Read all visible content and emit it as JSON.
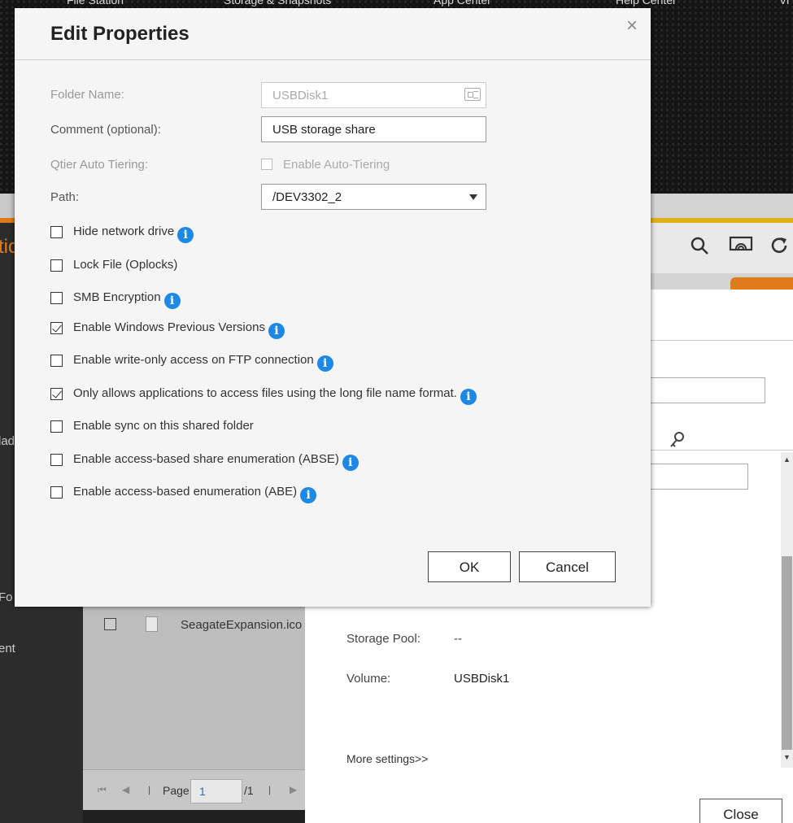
{
  "background": {
    "topnav": [
      "File Station",
      "Storage & Snapshots",
      "App Center",
      "Help Center",
      "Vi"
    ],
    "left_fragments": [
      "tic",
      "lad",
      "Fo",
      "ent"
    ],
    "file_list": {
      "rows": [
        {
          "name": "SeagateExpansion.ico"
        }
      ]
    },
    "pager": {
      "page_label": "Page",
      "page_value": "1",
      "page_total": "/1"
    },
    "details": {
      "storage_pool_label": "Storage Pool:",
      "storage_pool_value": "--",
      "volume_label": "Volume:",
      "volume_value": "USBDisk1",
      "more_settings": "More settings>>",
      "close_label": "Close"
    }
  },
  "modal": {
    "title": "Edit Properties",
    "close_glyph": "×",
    "folder_name": {
      "label": "Folder Name:",
      "value": "USBDisk1"
    },
    "comment": {
      "label": "Comment (optional):",
      "value": "USB storage share"
    },
    "qtier": {
      "label": "Qtier Auto Tiering:",
      "checkbox_label": "Enable Auto-Tiering"
    },
    "path": {
      "label": "Path:",
      "value": "/DEV3302_2"
    },
    "options": [
      {
        "label": "Hide network drive",
        "checked": false,
        "info": true
      },
      {
        "label": "Lock File (Oplocks)",
        "checked": false,
        "info": false
      },
      {
        "label": "SMB Encryption",
        "checked": false,
        "info": true
      },
      {
        "label": "Enable Windows Previous Versions",
        "checked": true,
        "info": true
      },
      {
        "label": "Enable write-only access on FTP connection",
        "checked": false,
        "info": true
      },
      {
        "label": "Only allows applications to access files using the long file name format.",
        "checked": true,
        "info": true
      },
      {
        "label": "Enable sync on this shared folder",
        "checked": false,
        "info": false
      },
      {
        "label": "Enable access-based share enumeration (ABSE)",
        "checked": false,
        "info": true
      },
      {
        "label": "Enable access-based enumeration (ABE)",
        "checked": false,
        "info": true
      }
    ],
    "ok_label": "OK",
    "cancel_label": "Cancel"
  },
  "colors": {
    "info": "#1e88e5",
    "orange": "#e07b1a",
    "yellow": "#e0b11a"
  },
  "icons": [
    "search-icon",
    "wifi-display-icon",
    "refresh-icon",
    "key-icon",
    "info-icon",
    "id-card-icon",
    "close-icon"
  ]
}
